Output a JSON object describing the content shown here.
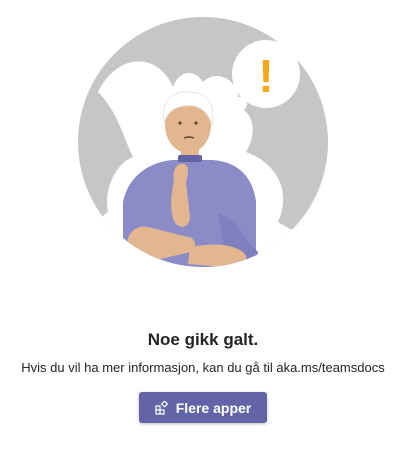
{
  "error": {
    "title": "Noe gikk galt.",
    "message": "Hvis du vil ha mer informasjon, kan du gå til aka.ms/teamsdocs"
  },
  "more_apps_button": {
    "label": "Flere apper",
    "icon": "apps-icon"
  },
  "illustration": {
    "thought_bubble_glyph": "!"
  },
  "colors": {
    "accent": "#6264a7",
    "circle": "#c8c6c4",
    "shirt": "#8b8cc7",
    "skin": "#e2b790",
    "exclamation": "#f8a81c"
  }
}
